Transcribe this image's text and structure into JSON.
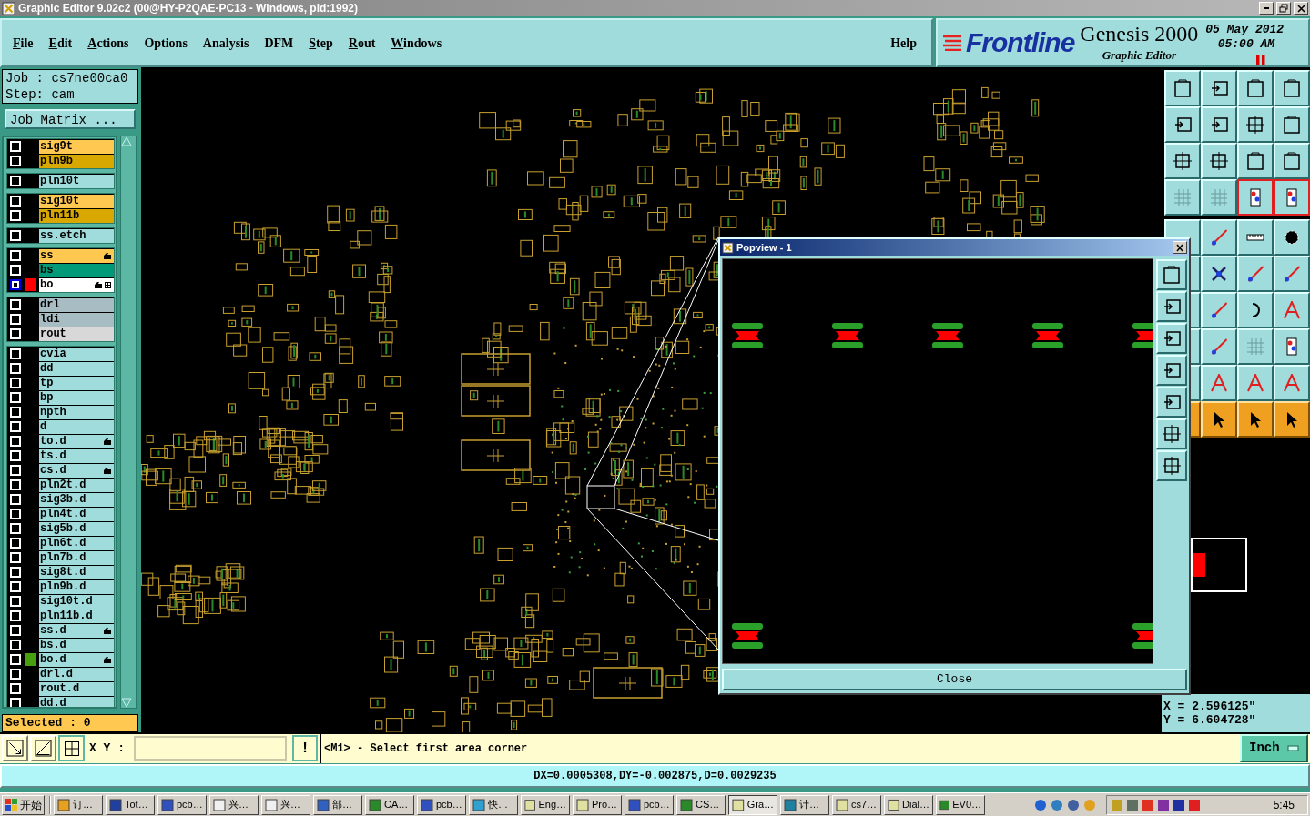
{
  "window": {
    "title": "Graphic Editor 9.02c2 (00@HY-P2QAE-PC13 - Windows, pid:1992)"
  },
  "menu": [
    {
      "label": "File",
      "mnemonic": true
    },
    {
      "label": "Edit",
      "mnemonic": true
    },
    {
      "label": "Actions",
      "mnemonic": true
    },
    {
      "label": "Options",
      "mnemonic": false
    },
    {
      "label": "Analysis",
      "mnemonic": false
    },
    {
      "label": "DFM",
      "mnemonic": false
    },
    {
      "label": "Step",
      "mnemonic": true
    },
    {
      "label": "Rout",
      "mnemonic": true
    },
    {
      "label": "Windows",
      "mnemonic": true
    }
  ],
  "help": "Help",
  "branding": {
    "logo": "Frontline",
    "product": "Genesis 2000",
    "subtitle": "Graphic Editor",
    "date": "05 May 2012",
    "time": "05:00 AM"
  },
  "job": {
    "job": "Job : cs7ne00ca0",
    "step": "Step: cam",
    "matrix_button": "Job Matrix ..."
  },
  "layer_groups": [
    [
      {
        "name": "sig9t",
        "color": "#ffc850",
        "affected": false,
        "work": false,
        "selected": false,
        "displayed": false
      },
      {
        "name": "pln9b",
        "color": "#d8a800",
        "affected": false,
        "work": false,
        "selected": false,
        "displayed": false
      }
    ],
    [
      {
        "name": "pln10t",
        "color": "#a0dcdc",
        "affected": false,
        "work": false,
        "selected": false,
        "displayed": false
      }
    ],
    [
      {
        "name": "sig10t",
        "color": "#ffc850",
        "affected": false,
        "work": false,
        "selected": false,
        "displayed": false
      },
      {
        "name": "pln11b",
        "color": "#d8a800",
        "affected": false,
        "work": false,
        "selected": false,
        "displayed": false
      }
    ],
    [
      {
        "name": "ss.etch",
        "color": "#a0dcdc",
        "affected": false,
        "work": false,
        "selected": false,
        "displayed": false
      }
    ],
    [
      {
        "name": "ss",
        "color": "#ffc850",
        "affected": true,
        "work": false,
        "selected": false,
        "displayed": false
      },
      {
        "name": "bs",
        "color": "#009a78",
        "affected": false,
        "work": false,
        "selected": false,
        "displayed": false
      },
      {
        "name": "bo",
        "color": "#ffffff",
        "affected": true,
        "work": true,
        "selected": true
      }
    ],
    [
      {
        "name": "drl",
        "color": "#a8bcc4",
        "affected": false,
        "work": false,
        "selected": false,
        "displayed": false
      },
      {
        "name": "ldi",
        "color": "#a8bcc4",
        "affected": false,
        "work": false,
        "selected": false,
        "displayed": false
      },
      {
        "name": "rout",
        "color": "#d8d8d8",
        "affected": false,
        "work": false,
        "selected": false,
        "displayed": false
      }
    ],
    [
      {
        "name": "cvia",
        "color": "#a0dcdc",
        "affected": false,
        "work": false,
        "selected": false,
        "displayed": false
      },
      {
        "name": "dd",
        "color": "#a0dcdc",
        "affected": false,
        "work": false,
        "selected": false,
        "displayed": false
      },
      {
        "name": "tp",
        "color": "#a0dcdc",
        "affected": false,
        "work": false,
        "selected": false,
        "displayed": false
      },
      {
        "name": "bp",
        "color": "#a0dcdc",
        "affected": false,
        "work": false,
        "selected": false,
        "displayed": false
      },
      {
        "name": "npth",
        "color": "#a0dcdc",
        "affected": false,
        "work": false,
        "selected": false,
        "displayed": false
      },
      {
        "name": "d",
        "color": "#a0dcdc",
        "affected": false,
        "work": false,
        "selected": false,
        "displayed": false
      },
      {
        "name": "to.d",
        "color": "#a0dcdc",
        "affected": true,
        "work": false,
        "selected": false,
        "displayed": false
      },
      {
        "name": "ts.d",
        "color": "#a0dcdc",
        "affected": false,
        "work": false,
        "selected": false,
        "displayed": false
      },
      {
        "name": "cs.d",
        "color": "#a0dcdc",
        "affected": true,
        "work": false,
        "selected": false,
        "displayed": false
      },
      {
        "name": "pln2t.d",
        "color": "#a0dcdc",
        "affected": false,
        "work": false,
        "selected": false,
        "displayed": false
      },
      {
        "name": "sig3b.d",
        "color": "#a0dcdc",
        "affected": false,
        "work": false,
        "selected": false,
        "displayed": false
      },
      {
        "name": "pln4t.d",
        "color": "#a0dcdc",
        "affected": false,
        "work": false,
        "selected": false,
        "displayed": false
      },
      {
        "name": "sig5b.d",
        "color": "#a0dcdc",
        "affected": false,
        "work": false,
        "selected": false,
        "displayed": false
      },
      {
        "name": "pln6t.d",
        "color": "#a0dcdc",
        "affected": false,
        "work": false,
        "selected": false,
        "displayed": false
      },
      {
        "name": "pln7b.d",
        "color": "#a0dcdc",
        "affected": false,
        "work": false,
        "selected": false,
        "displayed": false
      },
      {
        "name": "sig8t.d",
        "color": "#a0dcdc",
        "affected": false,
        "work": false,
        "selected": false,
        "displayed": false
      },
      {
        "name": "pln9b.d",
        "color": "#a0dcdc",
        "affected": false,
        "work": false,
        "selected": false,
        "displayed": false
      },
      {
        "name": "sig10t.d",
        "color": "#a0dcdc",
        "affected": false,
        "work": false,
        "selected": false,
        "displayed": false
      },
      {
        "name": "pln11b.d",
        "color": "#a0dcdc",
        "affected": false,
        "work": false,
        "selected": false,
        "displayed": false
      },
      {
        "name": "ss.d",
        "color": "#a0dcdc",
        "affected": true,
        "work": false,
        "selected": false,
        "displayed": false
      },
      {
        "name": "bs.d",
        "color": "#a0dcdc",
        "affected": false,
        "work": false,
        "selected": false,
        "displayed": false
      },
      {
        "name": "bo.d",
        "color": "#a0dcdc",
        "affected": true,
        "work": false,
        "selected": false,
        "displayed": true
      },
      {
        "name": "drl.d",
        "color": "#a0dcdc",
        "affected": false,
        "work": false,
        "selected": false,
        "displayed": false
      },
      {
        "name": "rout.d",
        "color": "#a0dcdc",
        "affected": false,
        "work": false,
        "selected": false,
        "displayed": false
      },
      {
        "name": "dd.d",
        "color": "#a0dcdc",
        "affected": false,
        "work": false,
        "selected": false,
        "displayed": false
      }
    ]
  ],
  "selected_count": "Selected : 0",
  "toolbar_top": [
    {
      "active": false
    },
    {
      "active": false
    },
    {
      "active": false
    },
    {
      "active": false
    },
    {
      "active": false
    },
    {
      "active": false
    },
    {
      "active": false
    },
    {
      "active": false
    },
    {
      "active": false
    },
    {
      "active": false
    },
    {
      "active": false
    },
    {
      "active": false
    },
    {
      "active": false
    },
    {
      "active": false
    },
    {
      "active": true
    },
    {
      "active": true
    }
  ],
  "toolbar_bottom": [
    {
      "active": false
    },
    {
      "active": false
    },
    {
      "active": false
    },
    {
      "active": false
    },
    {
      "active": false
    },
    {
      "active": false
    },
    {
      "active": false
    },
    {
      "active": false
    },
    {
      "active": false
    },
    {
      "active": false
    },
    {
      "active": false
    },
    {
      "active": false
    },
    {
      "active": false
    },
    {
      "active": false
    },
    {
      "active": false
    },
    {
      "active": false
    },
    {
      "active": false
    },
    {
      "active": false
    },
    {
      "active": false
    },
    {
      "active": false
    },
    {
      "active": true
    },
    {
      "active": true
    },
    {
      "active": true
    },
    {
      "active": true
    }
  ],
  "popview": {
    "title": "Popview - 1",
    "close_button": "Close"
  },
  "coordinates": {
    "x": "X = 2.596125\"",
    "y": "Y = 6.604728\""
  },
  "command_bar": {
    "xy_label": "X Y :",
    "confirm_button": "!",
    "message": "<M1> - Select first area corner",
    "units": "Inch"
  },
  "status": "DX=0.0005308,DY=-0.002875,D=0.0029235",
  "taskbar": {
    "start": "开始",
    "items": [
      {
        "label": "订…",
        "selected": false
      },
      {
        "label": "Tot…",
        "selected": false
      },
      {
        "label": "pcb…",
        "selected": false
      },
      {
        "label": "兴…",
        "selected": false
      },
      {
        "label": "兴…",
        "selected": false
      },
      {
        "label": "部…",
        "selected": false
      },
      {
        "label": "CA…",
        "selected": false
      },
      {
        "label": "pcb…",
        "selected": false
      },
      {
        "label": "快…",
        "selected": false
      },
      {
        "label": "Eng…",
        "selected": false
      },
      {
        "label": "Pro…",
        "selected": false
      },
      {
        "label": "pcb…",
        "selected": false
      },
      {
        "label": "CS…",
        "selected": false
      },
      {
        "label": "Gra…",
        "selected": true
      },
      {
        "label": "计…",
        "selected": false
      },
      {
        "label": "cs7…",
        "selected": false
      },
      {
        "label": "Dial…",
        "selected": false
      },
      {
        "label": "EV0…",
        "selected": false
      }
    ],
    "clock": "5:45"
  }
}
